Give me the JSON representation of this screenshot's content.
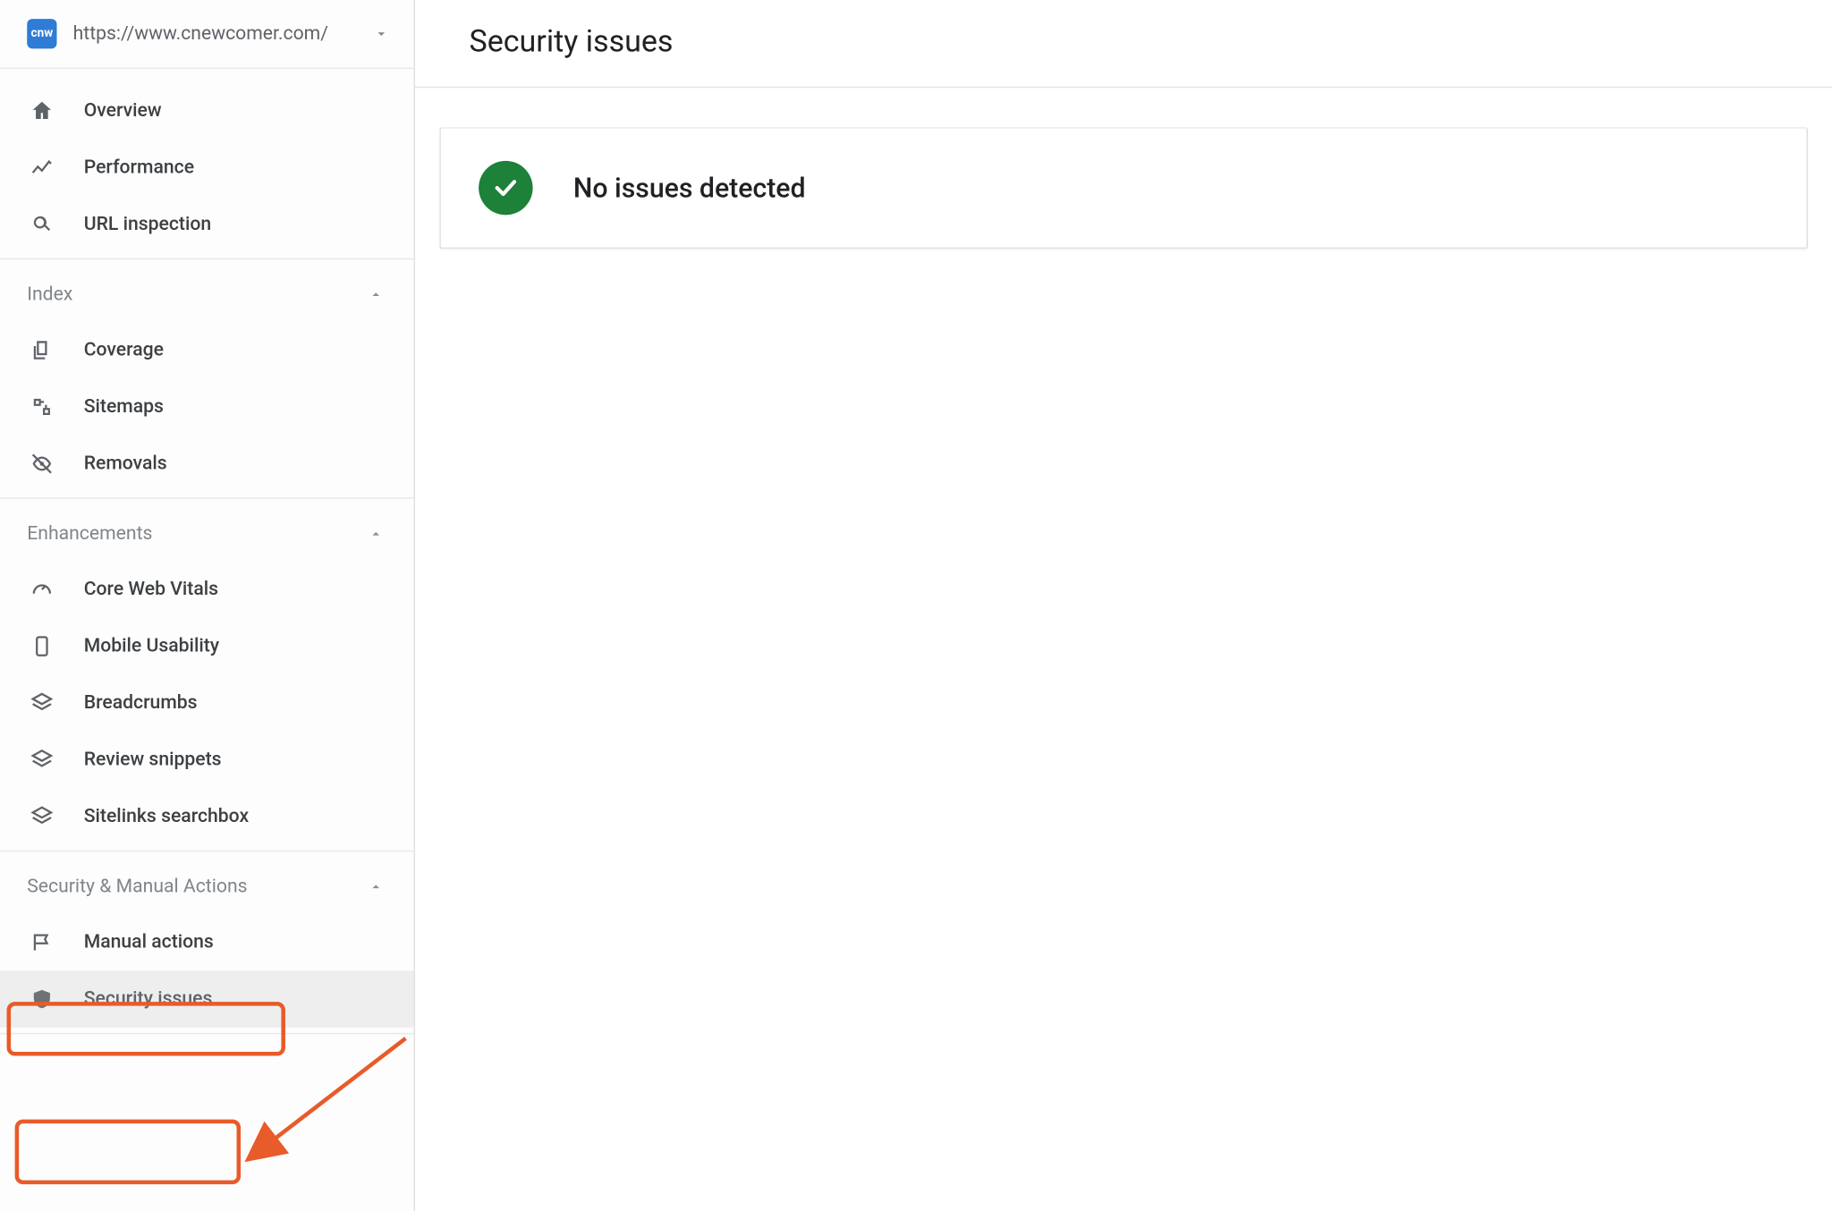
{
  "site": {
    "badge_text": "cnw",
    "url": "https://www.cnewcomer.com/"
  },
  "nav": {
    "top": [
      {
        "icon": "home",
        "label": "Overview"
      },
      {
        "icon": "trend",
        "label": "Performance"
      },
      {
        "icon": "search",
        "label": "URL inspection"
      }
    ],
    "sections": [
      {
        "title": "Index",
        "items": [
          {
            "icon": "copy",
            "label": "Coverage"
          },
          {
            "icon": "sitemap",
            "label": "Sitemaps"
          },
          {
            "icon": "eye-off",
            "label": "Removals"
          }
        ]
      },
      {
        "title": "Enhancements",
        "items": [
          {
            "icon": "speed",
            "label": "Core Web Vitals"
          },
          {
            "icon": "mobile",
            "label": "Mobile Usability"
          },
          {
            "icon": "layers",
            "label": "Breadcrumbs"
          },
          {
            "icon": "layers",
            "label": "Review snippets"
          },
          {
            "icon": "layers",
            "label": "Sitelinks searchbox"
          }
        ]
      },
      {
        "title": "Security & Manual Actions",
        "items": [
          {
            "icon": "flag",
            "label": "Manual actions"
          },
          {
            "icon": "shield",
            "label": "Security issues",
            "selected": true
          }
        ]
      }
    ]
  },
  "main": {
    "title": "Security issues",
    "status_message": "No issues detected"
  }
}
